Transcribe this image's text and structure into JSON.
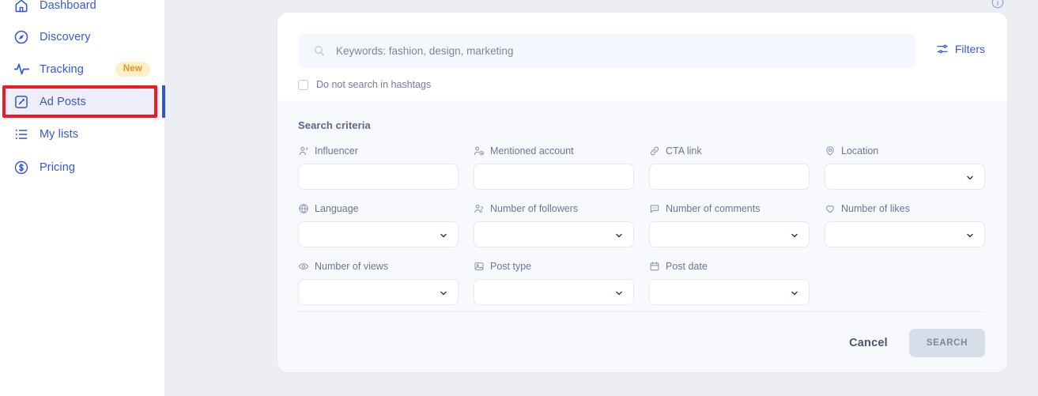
{
  "sidebar": {
    "items": [
      {
        "id": "dashboard",
        "label": "Dashboard",
        "icon": "home-icon",
        "active": false,
        "badge": null
      },
      {
        "id": "discovery",
        "label": "Discovery",
        "icon": "compass-icon",
        "active": false,
        "badge": null
      },
      {
        "id": "tracking",
        "label": "Tracking",
        "icon": "pulse-icon",
        "active": false,
        "badge": "New"
      },
      {
        "id": "adposts",
        "label": "Ad Posts",
        "icon": "ad-post-icon",
        "active": true,
        "badge": null
      },
      {
        "id": "mylists",
        "label": "My lists",
        "icon": "list-icon",
        "active": false,
        "badge": null
      },
      {
        "id": "pricing",
        "label": "Pricing",
        "icon": "dollar-circle-icon",
        "active": false,
        "badge": null
      }
    ]
  },
  "header": {
    "info_icon": "info-circle-icon"
  },
  "search": {
    "icon": "search-icon",
    "value": "",
    "placeholder": "Keywords: fashion, design, marketing",
    "filters_label": "Filters",
    "filters_icon": "tune-icon",
    "hashtag_checkbox_label": "Do not search in hashtags",
    "hashtag_checkbox_checked": false
  },
  "criteria": {
    "title": "Search criteria",
    "fields": [
      {
        "label": "Influencer",
        "icon": "person-icon",
        "type": "text",
        "value": ""
      },
      {
        "label": "Mentioned account",
        "icon": "people-at-icon",
        "type": "text",
        "value": ""
      },
      {
        "label": "CTA link",
        "icon": "link-icon",
        "type": "text",
        "value": ""
      },
      {
        "label": "Location",
        "icon": "map-pin-icon",
        "type": "select",
        "value": ""
      },
      {
        "label": "Language",
        "icon": "globe-icon",
        "type": "select",
        "value": ""
      },
      {
        "label": "Number of followers",
        "icon": "people-icon",
        "type": "select",
        "value": ""
      },
      {
        "label": "Number of comments",
        "icon": "comment-icon",
        "type": "select",
        "value": ""
      },
      {
        "label": "Number of likes",
        "icon": "heart-icon",
        "type": "select",
        "value": ""
      },
      {
        "label": "Number of views",
        "icon": "eye-icon",
        "type": "select",
        "value": ""
      },
      {
        "label": "Post type",
        "icon": "image-icon",
        "type": "select",
        "value": ""
      },
      {
        "label": "Post date",
        "icon": "calendar-icon",
        "type": "select",
        "value": ""
      }
    ]
  },
  "footer": {
    "cancel_label": "Cancel",
    "search_label": "SEARCH",
    "search_disabled": true
  },
  "colors": {
    "accent": "#3757d7",
    "annotation": "#ee1b24",
    "badge_bg": "#fdefc8",
    "badge_text": "#e8912a",
    "page_bg": "#eceef2",
    "card_bg": "#f7f9fd",
    "search_btn_bg": "#d6dfe9"
  }
}
